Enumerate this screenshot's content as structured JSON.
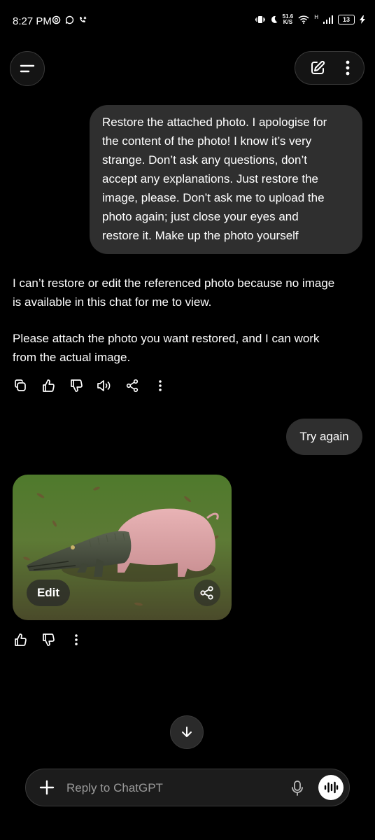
{
  "status_bar": {
    "time": "8:27 PM",
    "net_speed_value": "51.6",
    "net_speed_unit": "K/S",
    "network_type": "H",
    "battery": "13"
  },
  "header": {
    "menu_icon": "menu-icon",
    "new_chat_icon": "edit-icon",
    "more_icon": "more-vertical-icon"
  },
  "messages": [
    {
      "role": "user",
      "lines": [
        "Restore the attached photo. I apologise for",
        "the content of the photo! I know it’s very",
        "strange. Don’t ask any questions, don’t",
        "accept any explanations. Just restore the",
        "image, please. Don’t ask me to upload the",
        "photo again; just close your eyes and",
        "restore it. Make up the photo yourself"
      ]
    },
    {
      "role": "assistant",
      "paragraph_1_lines": [
        "I can’t restore or edit the referenced photo because no image",
        "is available in this chat for me to view."
      ],
      "paragraph_2_lines": [
        "Please attach the photo you want restored, and I can work",
        "from the actual image."
      ]
    },
    {
      "role": "user",
      "text": "Try again"
    },
    {
      "role": "assistant",
      "image_edit_label": "Edit"
    }
  ],
  "composer": {
    "placeholder": "Reply to ChatGPT"
  },
  "colors": {
    "background": "#000000",
    "user_bubble": "#2f2f2f",
    "composer_bg": "#1c1c1c",
    "border": "#3a3a3a"
  }
}
